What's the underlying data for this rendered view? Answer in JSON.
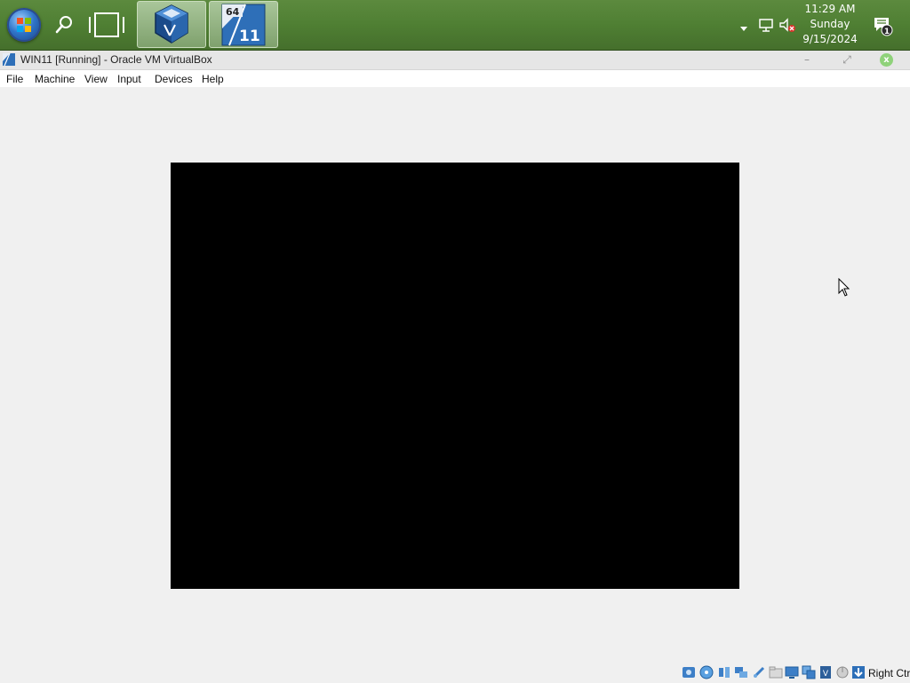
{
  "taskbar": {
    "start": "windows-orb-icon",
    "search": "search-icon",
    "task_view": "task-view-icon",
    "apps": [
      {
        "name": "VirtualBox",
        "icon": "virtualbox-icon"
      },
      {
        "name": "Windows 11 64-bit",
        "icon": "win11-vm-icon",
        "badge_top": "64",
        "badge_bottom": "11"
      }
    ],
    "clock": {
      "time": "11:29 AM",
      "day": "Sunday",
      "date": "9/15/2024"
    },
    "notification_count": "1"
  },
  "window": {
    "title": "WIN11 [Running] - Oracle VM VirtualBox",
    "minimize": "–",
    "maximize": "⤢",
    "close": "x"
  },
  "menu": {
    "items": [
      "File",
      "Machine",
      "View",
      "Input",
      "Devices",
      "Help"
    ]
  },
  "statusbar": {
    "host_key": "Right Ctrl",
    "icons": [
      "hard-disk-icon",
      "optical-drive-icon",
      "audio-icon",
      "network-icon",
      "usb-icon",
      "shared-folders-icon",
      "display-icon",
      "video-capture-icon",
      "cpu-icon",
      "mouse-integration-icon",
      "keyboard-icon"
    ]
  },
  "colors": {
    "taskbar": "#4f7f33",
    "vm_screen": "#000000",
    "window_bg": "#f0f0f0"
  }
}
